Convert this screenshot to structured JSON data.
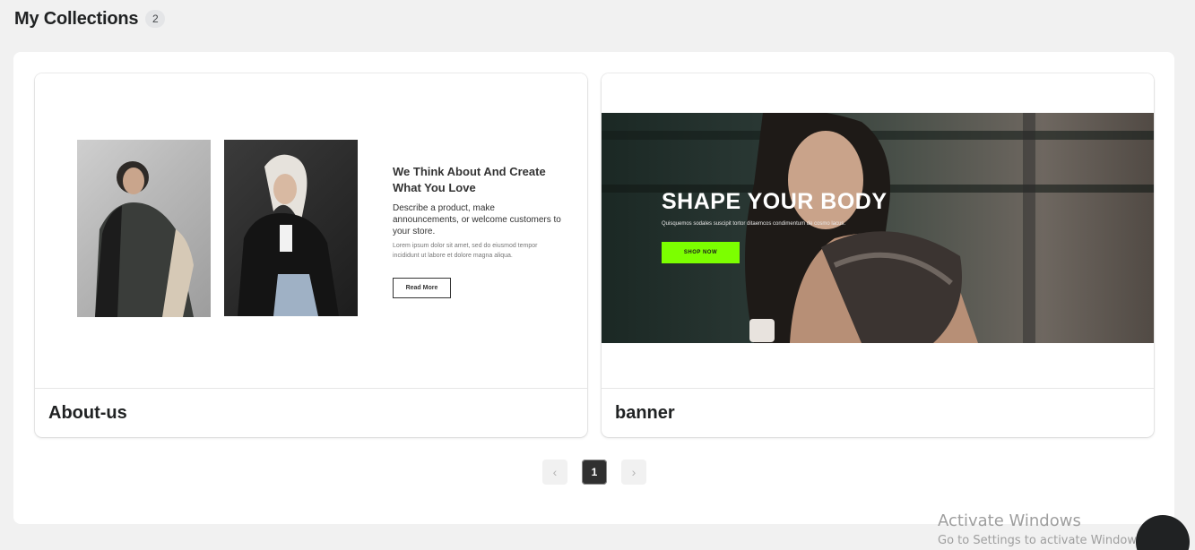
{
  "page": {
    "title": "My Collections",
    "count": "2"
  },
  "cards": [
    {
      "name": "About-us",
      "preview": {
        "heading": "We Think About And Create What You Love",
        "description": "Describe a product, make announcements, or welcome customers to your store.",
        "lorem": "Lorem ipsum dolor sit amet, sed do eiusmod tempor incididunt ut labore et dolore magna aliqua.",
        "button": "Read More"
      }
    },
    {
      "name": "banner",
      "preview": {
        "heading": "SHAPE YOUR BODY",
        "subtitle": "Quisquemos sodales suscipit tortor ditaemcos condimentum de cosmo lacus.",
        "button": "SHOP NOW"
      }
    }
  ],
  "pagination": {
    "prev": "‹",
    "current": "1",
    "next": "›"
  },
  "watermark": {
    "line1": "Activate Windows",
    "line2": "Go to Settings to activate Windows."
  }
}
